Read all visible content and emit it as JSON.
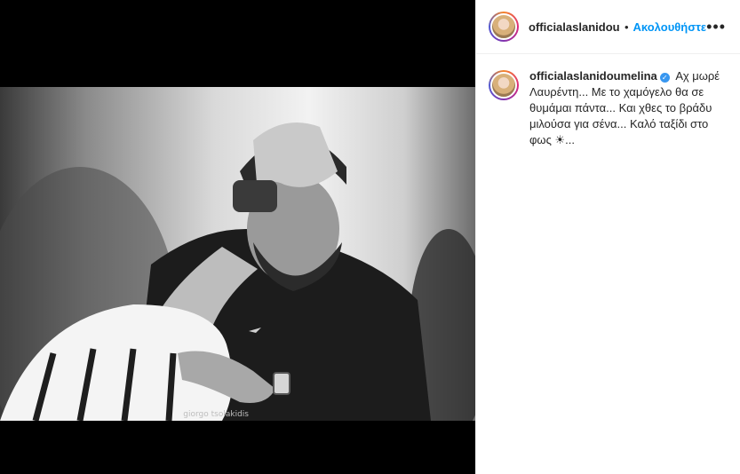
{
  "post": {
    "author": "officialaslanidoumelina",
    "header_username": "officialaslanidoumelina",
    "dot": "•",
    "follow_label": "Ακολουθήστε",
    "more_icon": "•••",
    "photo_credit": "giorgo tsolakidis",
    "verified_icon": "✓",
    "caption": "Αχ μωρέ Λαυρέντη... Με το χαμόγελο θα σε θυμάμαι πάντα... Και χθες το βράδυ μιλούσα για σένα... Καλό ταξίδι στο φως ☀..."
  },
  "colors": {
    "follow": "#0095f6",
    "verified": "#3897f0",
    "text": "#262626"
  }
}
